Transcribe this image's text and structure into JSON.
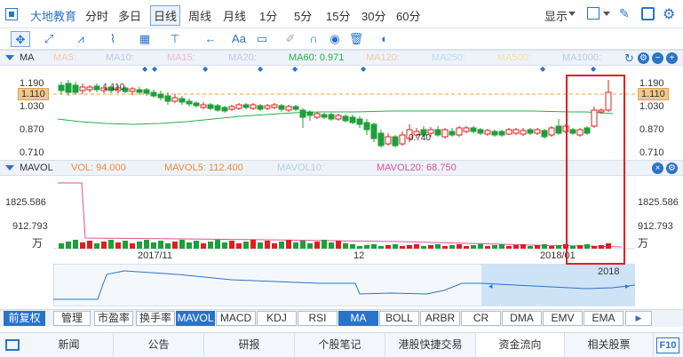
{
  "topbar": {
    "brand": "大地教育",
    "periods": [
      "分时",
      "多日",
      "日线",
      "周线",
      "月线",
      "1分",
      "5分",
      "15分",
      "30分",
      "60分"
    ],
    "active_period": "日线",
    "display_label": "显示"
  },
  "ma_panel": {
    "label": "MA",
    "items": [
      {
        "text": "MA5:",
        "color": "#f3c9b0"
      },
      {
        "text": "MA10:",
        "color": "#b6cde6"
      },
      {
        "text": "MA15:",
        "color": "#f0b8d6"
      },
      {
        "text": "MA20:",
        "color": "#b6cde6"
      },
      {
        "text": "MA60: 0.971",
        "color": "#22b14c"
      },
      {
        "text": "MA120:",
        "color": "#f3c9b0"
      },
      {
        "text": "MA250:",
        "color": "#b6e1f0"
      },
      {
        "text": "MA500:",
        "color": "#f3dfa0"
      },
      {
        "text": "MA1000:",
        "color": "#b6cde6"
      }
    ],
    "y_labels_left": [
      "1.190",
      "1.030",
      "0.870",
      "0.710"
    ],
    "y_labels_right": [
      "1.190",
      "1.030",
      "0.870",
      "0.710"
    ],
    "price_tag": "1.110",
    "annotation_high": "1.110",
    "annotation_low": "0.740"
  },
  "vol_panel": {
    "label": "MAVOL",
    "items": [
      {
        "text": "VOL: 94.000",
        "color": "#f08b3b"
      },
      {
        "text": "MAVOL5: 112.400",
        "color": "#f08b3b"
      },
      {
        "text": "MAVOL10:",
        "color": "#b6cde6"
      },
      {
        "text": "MAVOL20: 68.750",
        "color": "#d9539a"
      }
    ],
    "y_labels_left": [
      "1825.586",
      "912.793",
      "万"
    ],
    "y_labels_right": [
      "1825.586",
      "912.793",
      "万"
    ],
    "x_labels": [
      "2017/11",
      "12",
      "2018/01"
    ]
  },
  "navigator": {
    "year_label": "2018"
  },
  "indicator_tabs": {
    "left_label": "前复权",
    "tabs": [
      "管理",
      "市盈率",
      "换手率",
      "MAVOL",
      "MACD",
      "KDJ",
      "RSI",
      "MA",
      "BOLL",
      "ARBR",
      "CR",
      "DMA",
      "EMV",
      "EMA"
    ],
    "active": [
      "MAVOL",
      "MA"
    ]
  },
  "bottom_tabs": {
    "tabs": [
      "新闻",
      "公告",
      "研报",
      "个股笔记",
      "港股快捷交易",
      "资金流向",
      "相关股票"
    ],
    "active": "资金流向",
    "f10": "F10"
  },
  "colors": {
    "up": "#e01e1e",
    "down": "#1f9e3a",
    "ma60": "#22b14c",
    "accent": "#2a73c9"
  }
}
